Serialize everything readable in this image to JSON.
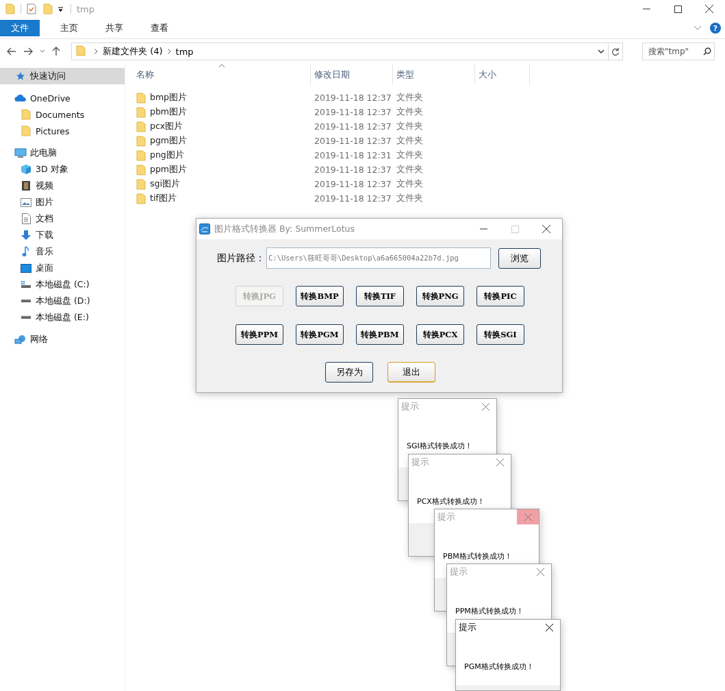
{
  "explorer": {
    "title": "tmp",
    "help_button": "?",
    "ribbon_tabs": [
      {
        "label": "文件",
        "kind": "file"
      },
      {
        "label": "主页",
        "kind": "tab"
      },
      {
        "label": "共享",
        "kind": "tab"
      },
      {
        "label": "查看",
        "kind": "tab"
      }
    ],
    "address": {
      "crumbs": [
        "新建文件夹 (4)",
        "tmp"
      ]
    },
    "search": {
      "placeholder": "搜索\"tmp\""
    },
    "nav_tree": [
      {
        "label": "快速访问",
        "kind": "star",
        "selected": true
      },
      {
        "label": "OneDrive",
        "kind": "cloud",
        "selected": false,
        "children": [
          {
            "label": "Documents",
            "kind": "folder",
            "selected": false
          },
          {
            "label": "Pictures",
            "kind": "folder",
            "selected": false
          }
        ]
      },
      {
        "label": "此电脑",
        "kind": "pc",
        "selected": false,
        "children": [
          {
            "label": "3D 对象",
            "kind": "cube",
            "selected": false
          },
          {
            "label": "视频",
            "kind": "video",
            "selected": false
          },
          {
            "label": "图片",
            "kind": "picture",
            "selected": false
          },
          {
            "label": "文档",
            "kind": "document",
            "selected": false
          },
          {
            "label": "下载",
            "kind": "download",
            "selected": false
          },
          {
            "label": "音乐",
            "kind": "music",
            "selected": false
          },
          {
            "label": "桌面",
            "kind": "desktop",
            "selected": false
          },
          {
            "label": "本地磁盘 (C:)",
            "kind": "system-drive",
            "selected": false
          },
          {
            "label": "本地磁盘 (D:)",
            "kind": "drive",
            "selected": false
          },
          {
            "label": "本地磁盘 (E:)",
            "kind": "drive",
            "selected": false
          }
        ]
      },
      {
        "label": "网络",
        "kind": "network",
        "selected": false
      }
    ],
    "columns": [
      {
        "label": "名称",
        "sorted": true
      },
      {
        "label": "修改日期",
        "sorted": false
      },
      {
        "label": "类型",
        "sorted": false
      },
      {
        "label": "大小",
        "sorted": false
      }
    ],
    "rows": [
      {
        "name": "bmp图片",
        "modified": "2019-11-18 12:37",
        "type": "文件夹"
      },
      {
        "name": "pbm图片",
        "modified": "2019-11-18 12:37",
        "type": "文件夹"
      },
      {
        "name": "pcx图片",
        "modified": "2019-11-18 12:37",
        "type": "文件夹"
      },
      {
        "name": "pgm图片",
        "modified": "2019-11-18 12:37",
        "type": "文件夹"
      },
      {
        "name": "png图片",
        "modified": "2019-11-18 12:31",
        "type": "文件夹"
      },
      {
        "name": "ppm图片",
        "modified": "2019-11-18 12:37",
        "type": "文件夹"
      },
      {
        "name": "sgi图片",
        "modified": "2019-11-18 12:37",
        "type": "文件夹"
      },
      {
        "name": "tif图片",
        "modified": "2019-11-18 12:37",
        "type": "文件夹"
      }
    ]
  },
  "converter": {
    "title": "图片格式转换器 By: SummerLotus",
    "path_label": "图片路径：",
    "path_value": "C:\\Users\\筱旺哥哥\\Desktop\\a6a665004a22b7d.jpg",
    "browse": "浏览",
    "convert_buttons": [
      {
        "label": "转换JPG",
        "disabled": true
      },
      {
        "label": "转换BMP",
        "disabled": false
      },
      {
        "label": "转换TIF",
        "disabled": false
      },
      {
        "label": "转换PNG",
        "disabled": false
      },
      {
        "label": "转换PIC",
        "disabled": false
      },
      {
        "label": "转换PPM",
        "disabled": false
      },
      {
        "label": "转换PGM",
        "disabled": false
      },
      {
        "label": "转换PBM",
        "disabled": false
      },
      {
        "label": "转换PCX",
        "disabled": false
      },
      {
        "label": "转换SGI",
        "disabled": false
      }
    ],
    "action_buttons": [
      {
        "label": "另存为",
        "focused": false
      },
      {
        "label": "退出",
        "focused": true
      }
    ]
  },
  "popups": [
    {
      "title": "提示",
      "message": "SGI格式转换成功！",
      "active": false,
      "close_hover": false
    },
    {
      "title": "提示",
      "message": "PCX格式转换成功！",
      "active": false,
      "close_hover": false
    },
    {
      "title": "提示",
      "message": "PBM格式转换成功！",
      "active": false,
      "close_hover": true
    },
    {
      "title": "提示",
      "message": "PPM格式转换成功！",
      "active": false,
      "close_hover": false
    },
    {
      "title": "提示",
      "message": "PGM格式转换成功！",
      "active": true,
      "close_hover": false
    }
  ]
}
